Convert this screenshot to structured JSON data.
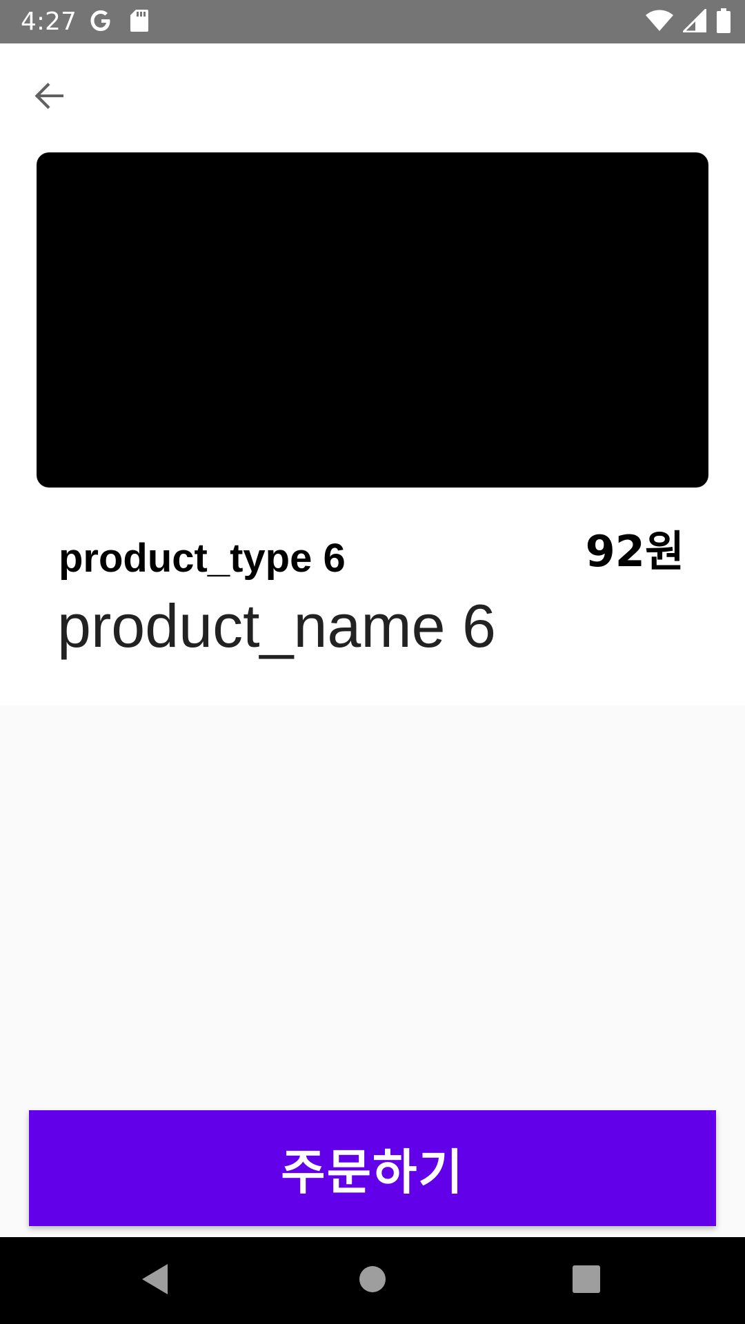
{
  "status_bar": {
    "time": "4:27",
    "left_icons": [
      "google-icon",
      "sd-card-icon"
    ],
    "right_icons": [
      "wifi-icon",
      "cellular-icon",
      "battery-icon"
    ]
  },
  "product": {
    "type": "product_type 6",
    "name": "product_name 6",
    "price": "92원"
  },
  "order_button": {
    "label": "주문하기"
  },
  "nav_bar": {
    "buttons": [
      "back-triangle-icon",
      "home-circle-icon",
      "recents-square-icon"
    ]
  },
  "colors": {
    "accent": "#6200ea",
    "status_bar": "#757575",
    "background": "#fafafa"
  }
}
